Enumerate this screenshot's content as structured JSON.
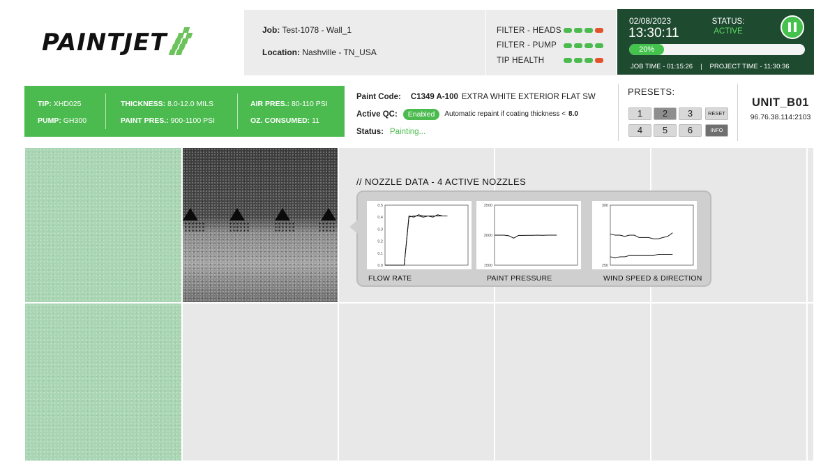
{
  "brand": {
    "name": "PAINTJET",
    "accent": "#4cbb4f",
    "dark": "#1e4a2f"
  },
  "job": {
    "job_label": "Job:",
    "job_value": "Test-1078 - Wall_1",
    "location_label": "Location:",
    "location_value": "Nashville  -  TN_USA"
  },
  "filters": [
    {
      "label": "FILTER - HEADS",
      "dots": [
        "green",
        "green",
        "green",
        "red"
      ]
    },
    {
      "label": "FILTER - PUMP",
      "dots": [
        "green",
        "green",
        "green",
        "green"
      ]
    },
    {
      "label": "TIP HEALTH",
      "dots": [
        "green",
        "green",
        "green",
        "red"
      ]
    }
  ],
  "status_panel": {
    "date": "02/08/2023",
    "time": "13:30:11",
    "status_label": "STATUS:",
    "status_value": "ACTIVE",
    "progress_text": "20%",
    "progress_fraction": 0.2,
    "job_time": "JOB TIME - 01:15:26",
    "separator": "|",
    "project_time": "PROJECT TIME - 11:30:36",
    "pause_icon": "pause-icon"
  },
  "specs": {
    "tip_label": "TIP:",
    "tip_value": "XHD025",
    "pump_label": "PUMP:",
    "pump_value": "GH300",
    "thickness_label": "THICKNESS:",
    "thickness_value": "8.0-12.0 MILS",
    "paint_pres_label": "PAINT PRES.:",
    "paint_pres_value": "900-1100 PSI",
    "air_pres_label": "AIR PRES.:",
    "air_pres_value": "80-110 PSI",
    "oz_label": "OZ. CONSUMED:",
    "oz_value": "11"
  },
  "paint": {
    "code_label": "Paint Code:",
    "code_value": "C1349 A-100",
    "code_desc": "EXTRA WHITE EXTERIOR FLAT SW",
    "qc_label": "Active QC:",
    "qc_badge": "Enabled",
    "qc_note": "Automatic repaint if coating thickness <",
    "qc_threshold": "8.0",
    "status_label": "Status:",
    "status_value": "Painting..."
  },
  "presets": {
    "title": "PRESETS:",
    "buttons": [
      "1",
      "2",
      "3",
      "RESET",
      "4",
      "5",
      "6",
      "INFO"
    ],
    "active": "2"
  },
  "unit": {
    "name": "UNIT_B01",
    "ip": "96.76.38.114:2103"
  },
  "nozzle": {
    "title": "// NOZZLE DATA - 4 ACTIVE NOZZLES",
    "active_nozzles": 4
  },
  "chart_data": [
    {
      "type": "line",
      "title": "FLOW RATE",
      "ylim": [
        0,
        0.5
      ],
      "yticks": [
        "0.5",
        "0.4",
        "0.3",
        "0.2",
        "0.1",
        "0.0"
      ],
      "series": [
        {
          "values": [
            0.0,
            0.0,
            0.0,
            0.0,
            0.0,
            0.4,
            0.41,
            0.41,
            0.4,
            0.41,
            0.41,
            0.41,
            0.41,
            0.41
          ]
        },
        {
          "values": [
            0.0,
            0.0,
            0.0,
            0.0,
            0.0,
            0.41,
            0.4,
            0.42,
            0.41,
            0.41,
            0.4,
            0.42,
            0.41,
            0.41
          ]
        }
      ]
    },
    {
      "type": "line",
      "title": "PAINT PRESSURE",
      "ylim": [
        1500,
        2500
      ],
      "yticks": [
        "2500",
        "2000",
        "1500"
      ],
      "series": [
        {
          "values": [
            2000,
            2000,
            2000,
            1990,
            1950,
            1995,
            1995,
            1998,
            1998,
            2000,
            1998,
            2000,
            2000,
            2000
          ]
        }
      ]
    },
    {
      "type": "line",
      "title": "WIND SPEED & DIRECTION",
      "ylim": [
        250,
        300
      ],
      "yticks": [
        "300",
        "250"
      ],
      "series": [
        {
          "values": [
            276,
            275,
            275,
            274,
            275,
            275,
            273,
            273,
            273,
            272,
            272,
            273,
            274,
            277
          ]
        },
        {
          "values": [
            257,
            256,
            257,
            257,
            258,
            258,
            258,
            258,
            258,
            258,
            259,
            259,
            259,
            259
          ]
        }
      ]
    }
  ]
}
